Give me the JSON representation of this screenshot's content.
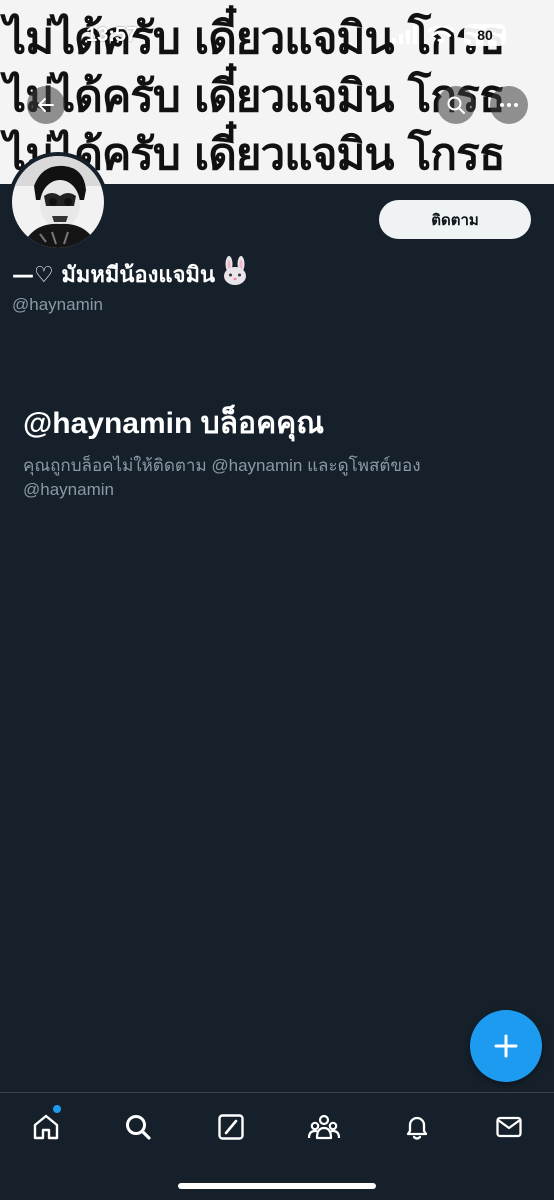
{
  "status_bar": {
    "time": "13:57",
    "battery": "80"
  },
  "banner": {
    "text": "ไม่ได้ครับ เดี๋ยวแจมิน โกรธ"
  },
  "profile": {
    "display_name": "—♡ มัมหมีน้องแจมิน",
    "name_emoji": "rabbit-face",
    "handle": "@haynamin",
    "follow_label": "ติดตาม"
  },
  "blocked": {
    "title": "@haynamin บล็อคคุณ",
    "description": "คุณถูกบล็อคไม่ให้ติดตาม @haynamin และดูโพสต์ของ @haynamin"
  },
  "tabbar": {
    "items": [
      "home-icon",
      "search-icon",
      "grok-icon",
      "communities-icon",
      "notifications-icon",
      "messages-icon"
    ],
    "home_has_notification": true
  },
  "colors": {
    "background": "#15202b",
    "accent": "#1d9bf0",
    "secondary_text": "#8b98a5",
    "follow_button_bg": "#eff3f4"
  }
}
